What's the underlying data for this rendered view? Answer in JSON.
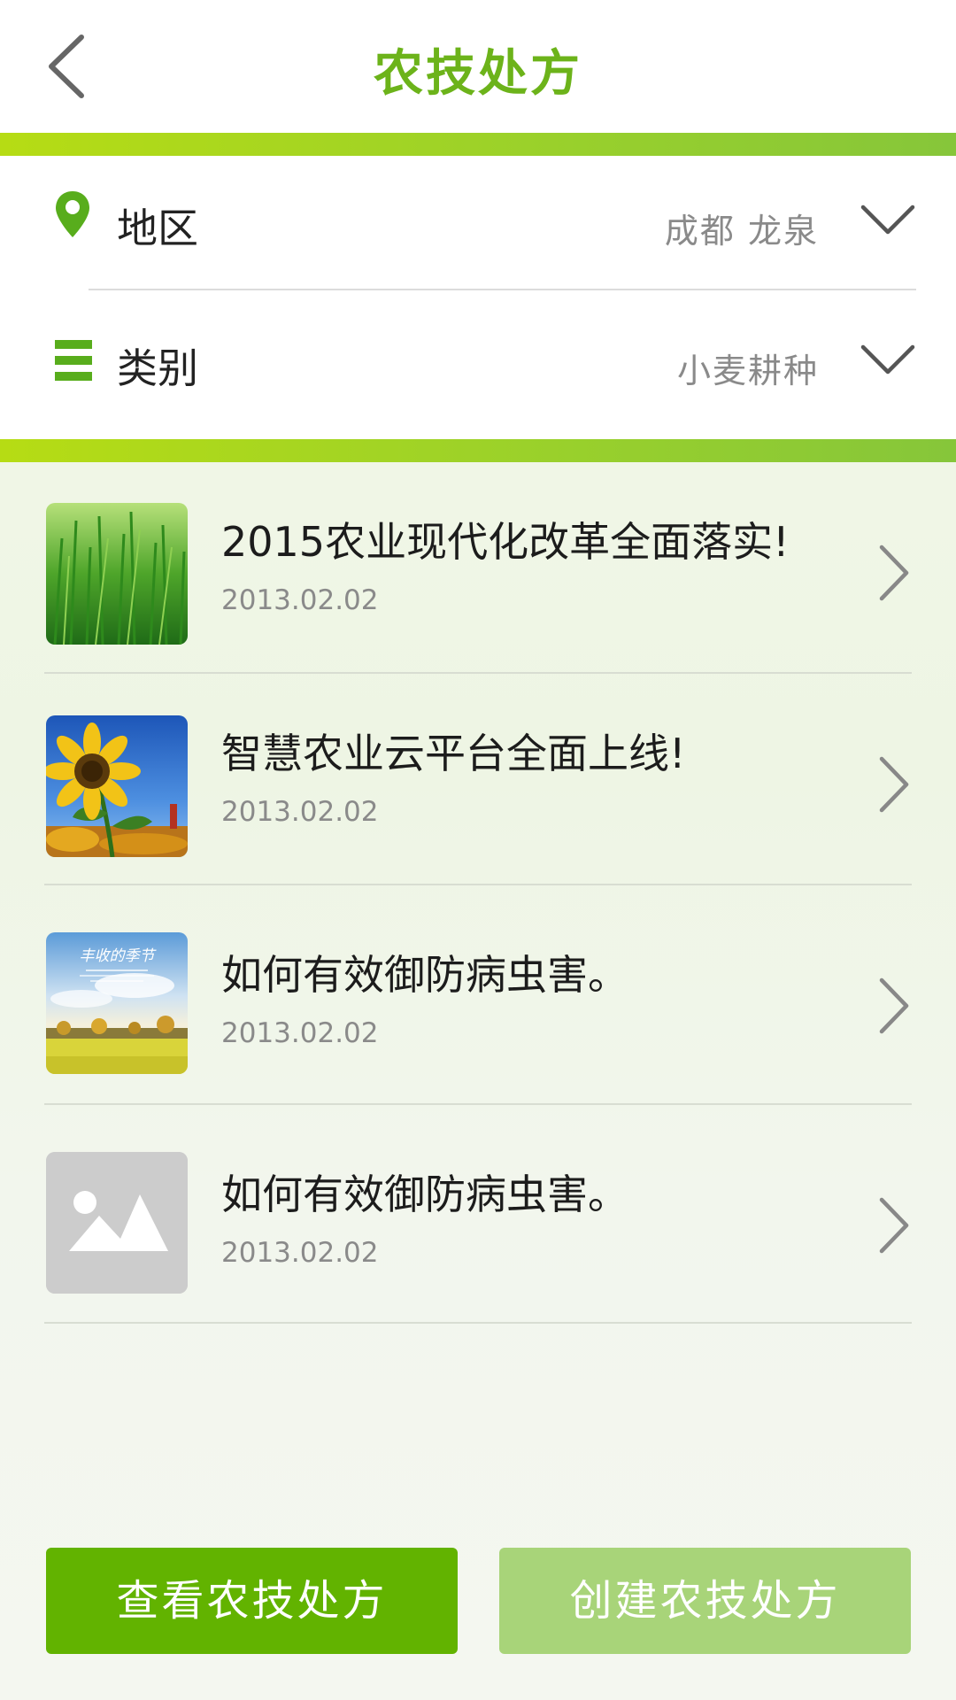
{
  "header": {
    "title": "农技处方"
  },
  "filters": {
    "region": {
      "label": "地区",
      "value": "成都 龙泉"
    },
    "category": {
      "label": "类别",
      "value": "小麦耕种"
    }
  },
  "list": {
    "items": [
      {
        "title": "2015农业现代化改革全面落实!",
        "date": "2013.02.02",
        "image": "rice-field-photo"
      },
      {
        "title": "智慧农业云平台全面上线!",
        "date": "2013.02.02",
        "image": "sunflower-photo"
      },
      {
        "title": "如何有效御防病虫害。",
        "date": "2013.02.02",
        "image": "harvest-season-poster",
        "image_text": "丰收的季节"
      },
      {
        "title": "如何有效御防病虫害。",
        "date": "2013.02.02",
        "image": "image-placeholder-icon"
      }
    ]
  },
  "buttons": {
    "view": "查看农技处方",
    "create": "创建农技处方"
  },
  "colors": {
    "accent": "#6cb31a",
    "primary_button": "#62b300",
    "secondary_button": "#a8d479"
  }
}
